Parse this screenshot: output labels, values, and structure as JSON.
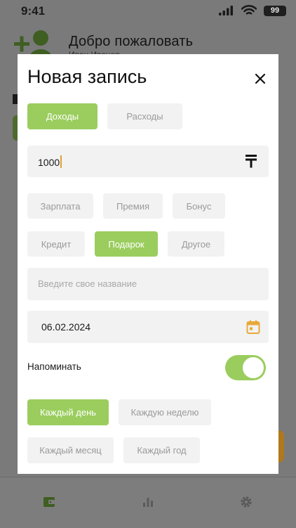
{
  "status_bar": {
    "time": "9:41",
    "battery": "99"
  },
  "background": {
    "welcome_title": "Добро пожаловать",
    "user_name": "Иван Иванов"
  },
  "modal": {
    "title": "Новая запись",
    "type_tabs": [
      {
        "label": "Доходы",
        "active": true
      },
      {
        "label": "Расходы",
        "active": false
      }
    ],
    "amount": {
      "value": "1000",
      "currency_icon": "tenge-icon"
    },
    "categories": [
      {
        "label": "Зарплата",
        "active": false
      },
      {
        "label": "Премия",
        "active": false
      },
      {
        "label": "Бонус",
        "active": false
      },
      {
        "label": "Кредит",
        "active": false
      },
      {
        "label": "Подарок",
        "active": true
      },
      {
        "label": "Другое",
        "active": false
      }
    ],
    "custom_name": {
      "placeholder": "Введите свое название",
      "value": ""
    },
    "date": {
      "value": "06.02.2024"
    },
    "reminder": {
      "label": "Напоминать",
      "enabled": true
    },
    "frequency": [
      {
        "label": "Каждый день",
        "active": true
      },
      {
        "label": "Каждую неделю",
        "active": false
      },
      {
        "label": "Каждый месяц",
        "active": false
      },
      {
        "label": "Каждый год",
        "active": false
      }
    ]
  },
  "colors": {
    "accent_green": "#9acd5e",
    "chip_gray": "#f2f2f2",
    "calendar_orange": "#e8a93a"
  }
}
